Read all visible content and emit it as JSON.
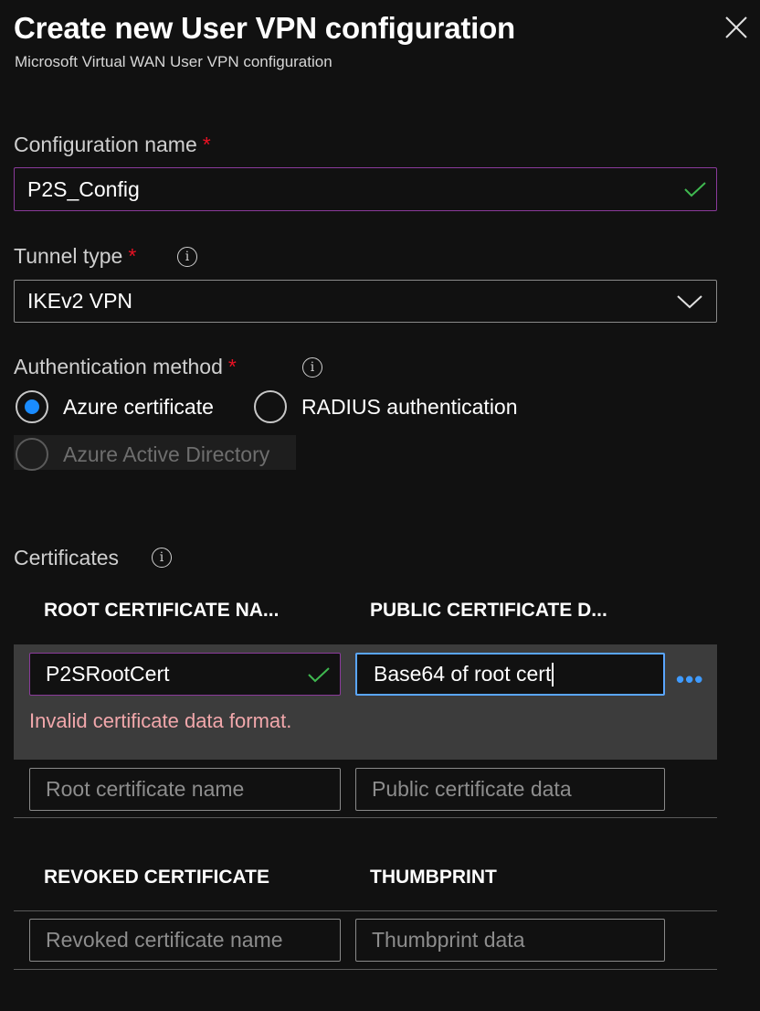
{
  "header": {
    "title": "Create new User VPN configuration",
    "subtitle": "Microsoft Virtual WAN User VPN configuration",
    "close_icon": "close-icon"
  },
  "form": {
    "config_name": {
      "label": "Configuration name",
      "required_mark": "*",
      "value": "P2S_Config"
    },
    "tunnel_type": {
      "label": "Tunnel type",
      "required_mark": "*",
      "info": "i",
      "value": "IKEv2 VPN"
    },
    "auth_method": {
      "label": "Authentication method",
      "required_mark": "*",
      "info": "i",
      "options": [
        {
          "label": "Azure certificate",
          "selected": true,
          "disabled": false
        },
        {
          "label": "RADIUS authentication",
          "selected": false,
          "disabled": false
        },
        {
          "label": "Azure Active Directory",
          "selected": false,
          "disabled": true
        }
      ]
    }
  },
  "certificates": {
    "label": "Certificates",
    "info": "i",
    "root_header_name": "ROOT CERTIFICATE NA...",
    "root_header_data": "PUBLIC CERTIFICATE D...",
    "row": {
      "name": "P2SRootCert",
      "data": "Base64 of root cert",
      "error": "Invalid certificate data format.",
      "more": "•••"
    },
    "new_row": {
      "name_placeholder": "Root certificate name",
      "data_placeholder": "Public certificate data"
    },
    "revoked_header_name": "REVOKED CERTIFICATE",
    "revoked_header_thumb": "THUMBPRINT",
    "revoked_row": {
      "name_placeholder": "Revoked certificate name",
      "thumb_placeholder": "Thumbprint data"
    }
  },
  "colors": {
    "background": "#111111",
    "accent": "#1a8cff",
    "valid_border": "#8a3a9a",
    "focus_border": "#5aa6ff",
    "error_text": "#f1a7ab",
    "required": "#e81123",
    "check": "#3fb950"
  }
}
